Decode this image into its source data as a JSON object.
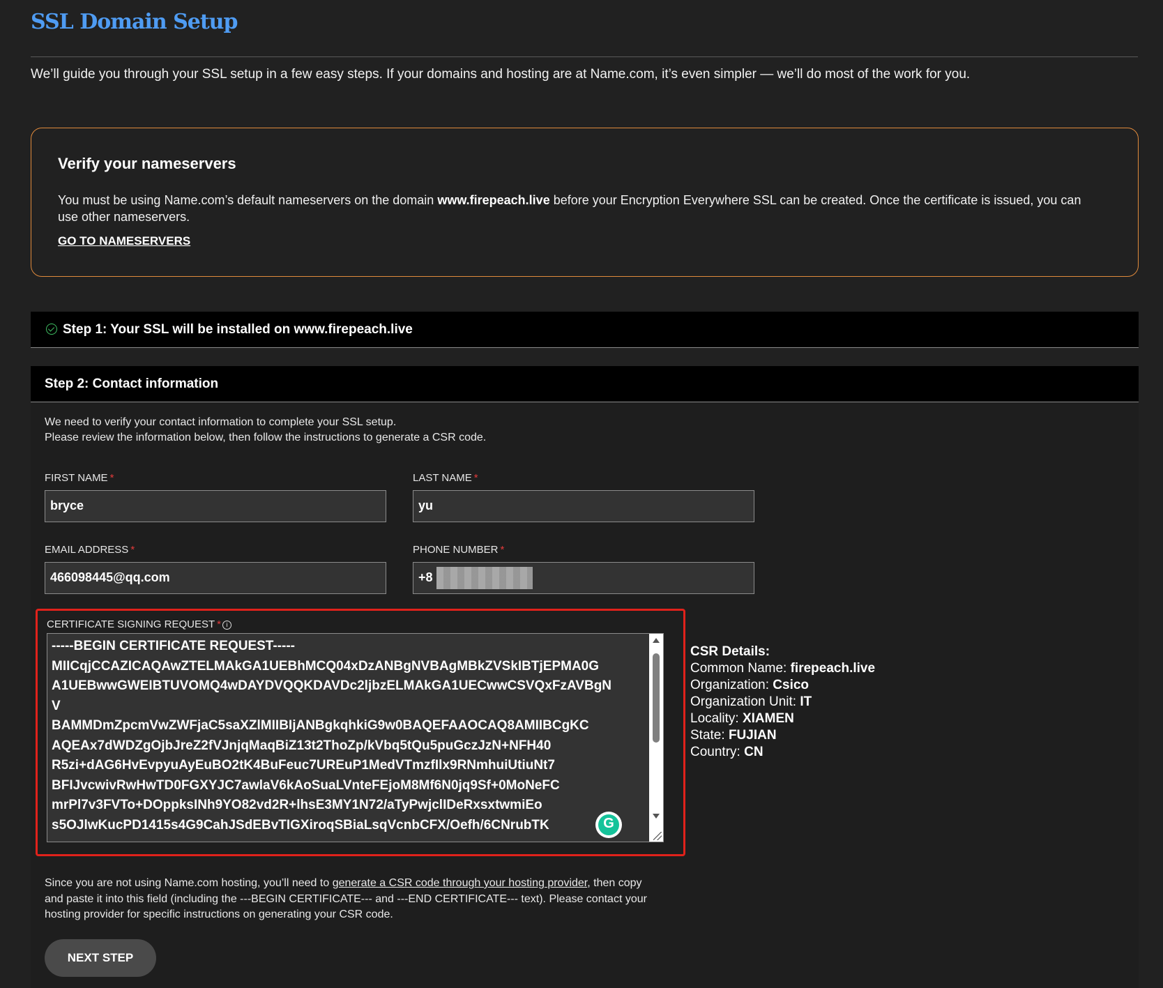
{
  "page": {
    "title": "SSL Domain Setup",
    "intro": "We’ll guide you through your SSL setup in a few easy steps. If your domains and hosting are at Name.com, it’s even simpler — we’ll do most of the work for you."
  },
  "nameservers": {
    "title": "Verify your nameservers",
    "text_before": "You must be using Name.com’s default nameservers on the domain ",
    "domain": "www.firepeach.live",
    "text_after": " before your Encryption Everywhere SSL can be created. Once the certificate is issued, you can use other nameservers.",
    "link_label": "GO TO NAMESERVERS",
    "border_color": "#e08a3c"
  },
  "step1": {
    "label": "Step 1: Your SSL will be installed on www.firepeach.live",
    "icon": "check-circle-icon"
  },
  "step2": {
    "label": "Step 2: Contact information",
    "desc_line1": "We need to verify your contact information to complete your SSL setup.",
    "desc_line2": "Please review the information below, then follow the instructions to generate a CSR code.",
    "required_mark": "*",
    "fields": {
      "first_name": {
        "label": "FIRST NAME",
        "value": "bryce"
      },
      "last_name": {
        "label": "LAST NAME",
        "value": "yu"
      },
      "email": {
        "label": "EMAIL ADDRESS",
        "value": "466098445@qq.com"
      },
      "phone": {
        "label": "PHONE NUMBER",
        "value": "+8"
      }
    },
    "csr": {
      "label": "CERTIFICATE SIGNING REQUEST",
      "info_icon": "info-icon",
      "value": "-----BEGIN CERTIFICATE REQUEST-----\nMIICqjCCAZICAQAwZTELMAkGA1UEBhMCQ04xDzANBgNVBAgMBkZVSkIBTjEPMA0G\nA1UEBwwGWEIBTUVOMQ4wDAYDVQQKDAVDc2ljbzELMAkGA1UECwwCSVQxFzAVBgN\nV\nBAMMDmZpcmVwZWFjaC5saXZlMIIBIjANBgkqhkiG9w0BAQEFAAOCAQ8AMIIBCgKC\nAQEAx7dWDZgOjbJreZ2fVJnjqMaqBiZ13t2ThoZp/kVbq5tQu5puGczJzN+NFH40\nR5zi+dAG6HvEvpyuAyEuBO2tK4BuFeuc7UREuP1MedVTmzfIlx9RNmhuiUtiuNt7\nBFIJvcwivRwHwTD0FGXYJC7awlaV6kAoSuaLVnteFEjoM8Mf6N0jq9Sf+0MoNeFC\nmrPl7v3FVTo+DOppksINh9YO82vd2R+lhsE3MY1N72/aTyPwjclIDeRxsxtwmiEo\ns5OJlwKucPD1415s4G9CahJSdEBvTIGXiroqSBiaLsqVcnbCFX/Oefh/6CNrubTK",
      "grammarly_glyph": "G"
    },
    "csr_details": {
      "heading": "CSR Details:",
      "common_name_label": "Common Name:",
      "common_name": "firepeach.live",
      "org_label": "Organization:",
      "org": "Csico",
      "org_unit_label": "Organization Unit:",
      "org_unit": "IT",
      "locality_label": "Locality:",
      "locality": "XIAMEN",
      "state_label": "State:",
      "state": "FUJIAN",
      "country_label": "Country:",
      "country": "CN"
    },
    "help": {
      "text_before": "Since you are not using Name.com hosting, you’ll need to ",
      "link": "generate a CSR code through your hosting provider",
      "text_after": ", then copy and paste it into this field (including the ---BEGIN CERTIFICATE--- and ---END CERTIFICATE--- text). Please contact your hosting provider for specific instructions on generating your CSR code."
    },
    "next_button": "NEXT STEP"
  },
  "colors": {
    "background": "#212121",
    "title_blue": "#4f9cf3",
    "highlight_red": "#e0221b",
    "success_green": "#3fbf62"
  }
}
